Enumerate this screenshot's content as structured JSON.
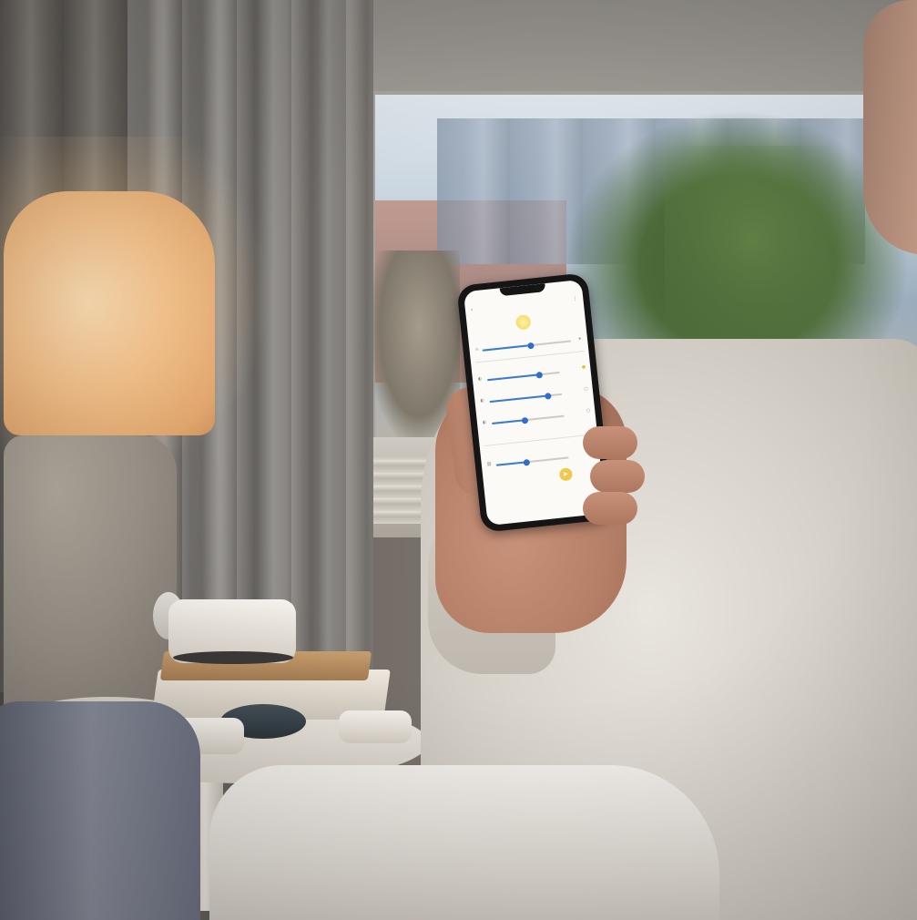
{
  "photo": {
    "subject": "person holding smartphone with smart home lighting app in living room",
    "colors": {
      "lamp_glow": "#f7c48d",
      "shirt": "#d7d2ca",
      "app_accent": "#2d6fc9",
      "app_highlight": "#f1c84b"
    }
  },
  "phone_app": {
    "title": "",
    "room_name": "",
    "section_name": "",
    "lights": [
      {
        "label": "",
        "level": 0.72
      },
      {
        "label": "",
        "level": 0.8
      },
      {
        "label": "",
        "level": 0.45
      }
    ],
    "master_level": 0.55,
    "speaker_level": 0.42,
    "icons": [
      "back-icon",
      "menu-icon",
      "bulb-icon",
      "play-icon"
    ]
  }
}
